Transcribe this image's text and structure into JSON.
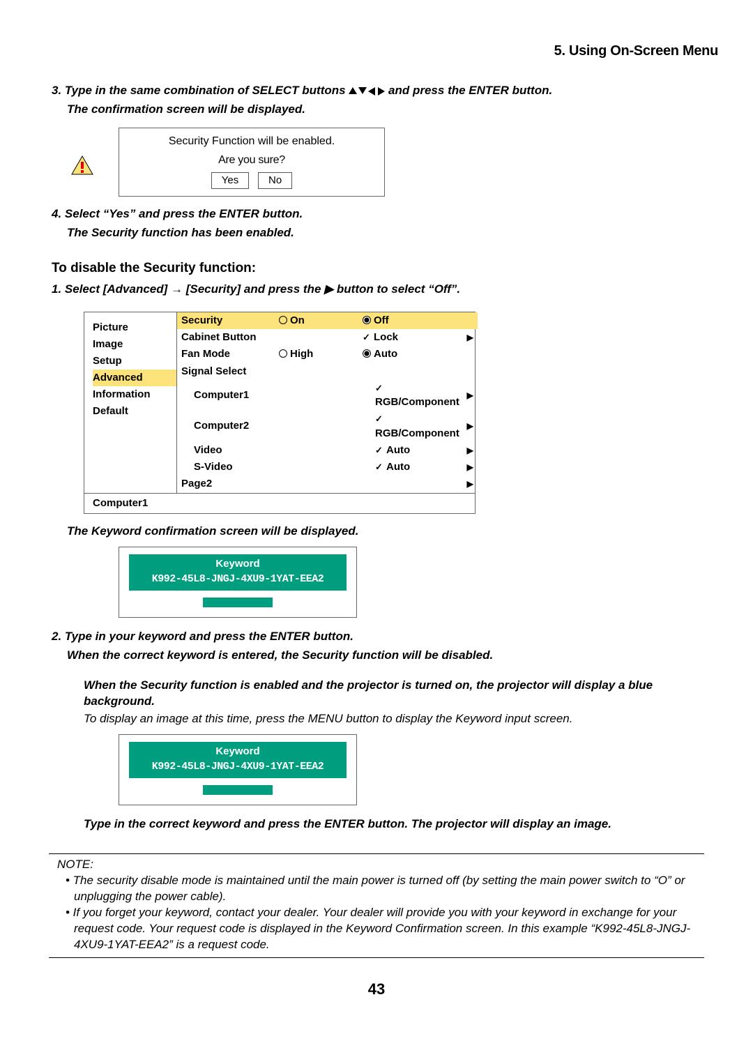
{
  "header": "5. Using On-Screen Menu",
  "step3_a": "3.  Type in the same combination of SELECT buttons ",
  "step3_b": " and press the ENTER button.",
  "step3_c": "The confirmation screen will be displayed.",
  "dialog": {
    "line1": "Security Function will be enabled.",
    "line2": "Are you sure?",
    "yes": "Yes",
    "no": "No"
  },
  "step4_a": "4.  Select “Yes” and press the ENTER button.",
  "step4_b": "The Security function has been enabled.",
  "disable_heading": "To disable the Security function:",
  "disable_step1": "1.  Select [Advanced] → [Security] and press the ▶ button to select “Off”.",
  "menu": {
    "left": [
      "Picture",
      "Image",
      "Setup",
      "Advanced",
      "Information",
      "Default"
    ],
    "left_selected": "Advanced",
    "rows": [
      {
        "lbl": "Security",
        "on": "On",
        "off": "Off",
        "off_checked": true,
        "hl": true
      },
      {
        "lbl": "Cabinet Button",
        "v1": "",
        "v2": "Lock",
        "chk": true,
        "arr": true
      },
      {
        "lbl": "Fan Mode",
        "radioHigh": "High",
        "radioAuto": "Auto",
        "auto_checked": true
      },
      {
        "lbl": "Signal Select"
      },
      {
        "lbl": "Computer1",
        "sub": true,
        "v2": "RGB/Component",
        "chk": true,
        "arr": true
      },
      {
        "lbl": "Computer2",
        "sub": true,
        "v2": "RGB/Component",
        "chk": true,
        "arr": true
      },
      {
        "lbl": "Video",
        "sub": true,
        "v2": "Auto",
        "chk": true,
        "arr": true
      },
      {
        "lbl": "S-Video",
        "sub": true,
        "v2": "Auto",
        "chk": true,
        "arr": true
      },
      {
        "lbl": "Page2",
        "arr": true
      }
    ],
    "status": "Computer1"
  },
  "kw_confirm": "The Keyword confirmation screen will be displayed.",
  "keyword": {
    "title": "Keyword",
    "code": "K992-45L8-JNGJ-4XU9-1YAT-EEA2"
  },
  "step2_a": "2.  Type in your keyword and press the ENTER button.",
  "step2_b": "When the correct keyword is entered, the Security function will be disabled.",
  "blue_bg": "When the Security function is enabled and the projector is turned on, the projector will display a blue background.",
  "blue_bg2": "To display an image at this time, press the MENU button to display the Keyword input screen.",
  "final_line": "Type in the correct keyword and press the ENTER button. The projector will display an image.",
  "note_label": "NOTE:",
  "note1": "•  The security disable mode is maintained until the main power is turned off (by setting the main power switch to “O” or unplugging the power cable).",
  "note2": "•  If you forget your keyword, contact your dealer. Your dealer will provide you with your keyword in exchange for your request code. Your request code is displayed in the Keyword Confirmation screen. In this example “K992-45L8-JNGJ-4XU9-1YAT-EEA2” is a request code.",
  "pagenum": "43"
}
